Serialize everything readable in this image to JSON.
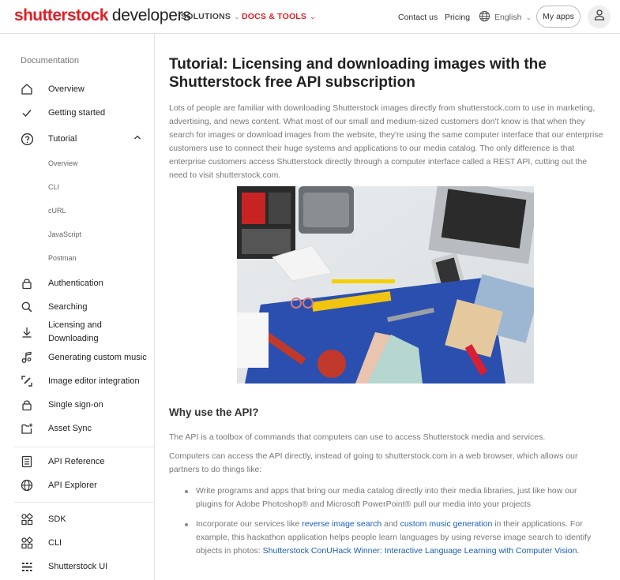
{
  "header": {
    "logo_brand": "shutterstock",
    "logo_suffix": "developers",
    "nav": {
      "solutions": "SOLUTIONS",
      "docs_tools": "DOCS & TOOLS"
    },
    "contact": "Contact us",
    "pricing": "Pricing",
    "language": "English",
    "my_apps": "My apps"
  },
  "sidebar": {
    "heading": "Documentation",
    "items": {
      "overview": "Overview",
      "getting_started": "Getting started",
      "tutorial": "Tutorial",
      "authentication": "Authentication",
      "searching": "Searching",
      "licensing_1": "Licensing and",
      "licensing_2": "Downloading",
      "music": "Generating custom music",
      "image_editor": "Image editor integration",
      "sso": "Single sign-on",
      "asset_sync": "Asset Sync",
      "api_reference": "API Reference",
      "api_explorer": "API Explorer",
      "sdk": "SDK",
      "cli": "CLI",
      "shutterstock_ui": "Shutterstock UI"
    },
    "tutorial_sub": [
      "Overview",
      "CLI",
      "cURL",
      "JavaScript",
      "Postman"
    ]
  },
  "main": {
    "title": "Tutorial: Licensing and downloading images with the Shutterstock free API subscription",
    "intro": "Lots of people are familiar with downloading Shutterstock images directly from shutterstock.com to use in marketing, advertising, and news content. What most of our small and medium-sized customers don't know is that when they search for images or download images from the website, they're using the same computer interface that our enterprise customers use to connect their huge systems and applications to our media catalog. The only difference is that enterprise customers access Shutterstock directly through a computer interface called a REST API, cutting out the need to visit shutterstock.com.",
    "section_heading": "Why use the API?",
    "p1": "The API is a toolbox of commands that computers can use to access Shutterstock media and services.",
    "p2": "Computers can access the API directly, instead of going to shutterstock.com in a web browser, which allows our partners to do things like:",
    "bullet1": "Write programs and apps that bring our media catalog directly into their media libraries, just like how our plugins for Adobe Photoshop® and Microsoft PowerPoint® pull our media into your projects",
    "bullet2_a": "Incorporate our services like ",
    "bullet2_link1": "reverse image search",
    "bullet2_b": " and ",
    "bullet2_link2": "custom music generation",
    "bullet2_c": " in their applications. For example, this hackathon application helps people learn languages by using reverse image search to identify objects in photos: ",
    "bullet2_link3": "Shutterstock ConUHack Winner: Interactive Language Learning with Computer Vision",
    "bullet2_d": "."
  },
  "colors": {
    "brand_red": "#e01f26",
    "link_blue": "#1a5db4",
    "text_gray": "#777777"
  }
}
